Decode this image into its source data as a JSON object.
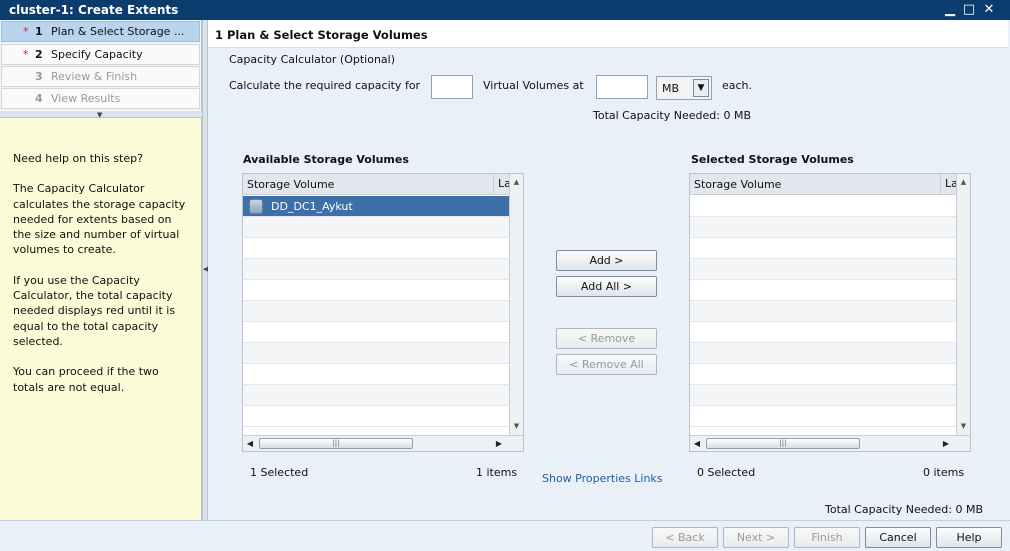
{
  "window": {
    "title": "cluster-1: Create Extents",
    "minimize": "▁",
    "maximize": "□",
    "close": "✕"
  },
  "steps": [
    {
      "star": "*",
      "num": "1",
      "label": "Plan & Select Storage ..."
    },
    {
      "star": "*",
      "num": "2",
      "label": "Specify Capacity"
    },
    {
      "star": "",
      "num": "3",
      "label": "Review & Finish"
    },
    {
      "star": "",
      "num": "4",
      "label": "View Results"
    }
  ],
  "help": {
    "p1": "Need help on this step?",
    "p2": "The Capacity Calculator calculates the storage capacity needed for extents based on the size and number of virtual volumes to create.",
    "p3": "If you use the Capacity Calculator, the total capacity needed displays red until it is equal to the total capacity selected.",
    "p4": "You can proceed if the two totals are not equal."
  },
  "main": {
    "header": "1  Plan & Select Storage Volumes",
    "calc_title": "Capacity Calculator (Optional)",
    "calc_label1": "Calculate the required capacity for",
    "calc_label2": "Virtual Volumes at",
    "calc_label3": "each.",
    "count_value": "",
    "size_value": "",
    "unit": "MB",
    "total_top": "Total Capacity Needed: 0 MB",
    "total_bottom": "Total Capacity Needed: 0 MB",
    "show_links": "Show Properties Links"
  },
  "available": {
    "title": "Available Storage Volumes",
    "col1": "Storage Volume",
    "col2": "La",
    "rows": [
      "DD_DC1_Aykut"
    ],
    "selected_count": "1 Selected",
    "items": "1 items"
  },
  "selected": {
    "title": "Selected Storage Volumes",
    "col1": "Storage Volume",
    "col2": "La",
    "selected_count": "0 Selected",
    "items": "0 items"
  },
  "transfer": {
    "add": "Add >",
    "add_all": "Add All >",
    "remove": "< Remove",
    "remove_all": "< Remove All"
  },
  "footer": {
    "back": "< Back",
    "next": "Next >",
    "finish": "Finish",
    "cancel": "Cancel",
    "help": "Help"
  },
  "scroll_grip": "|||",
  "colors": {
    "titlebar": "#0b3c6e",
    "selected_row": "#3d6fa8",
    "help_bg": "#fcfbd7",
    "active_step": "#b9d4ef",
    "required_star": "#dd2222"
  }
}
